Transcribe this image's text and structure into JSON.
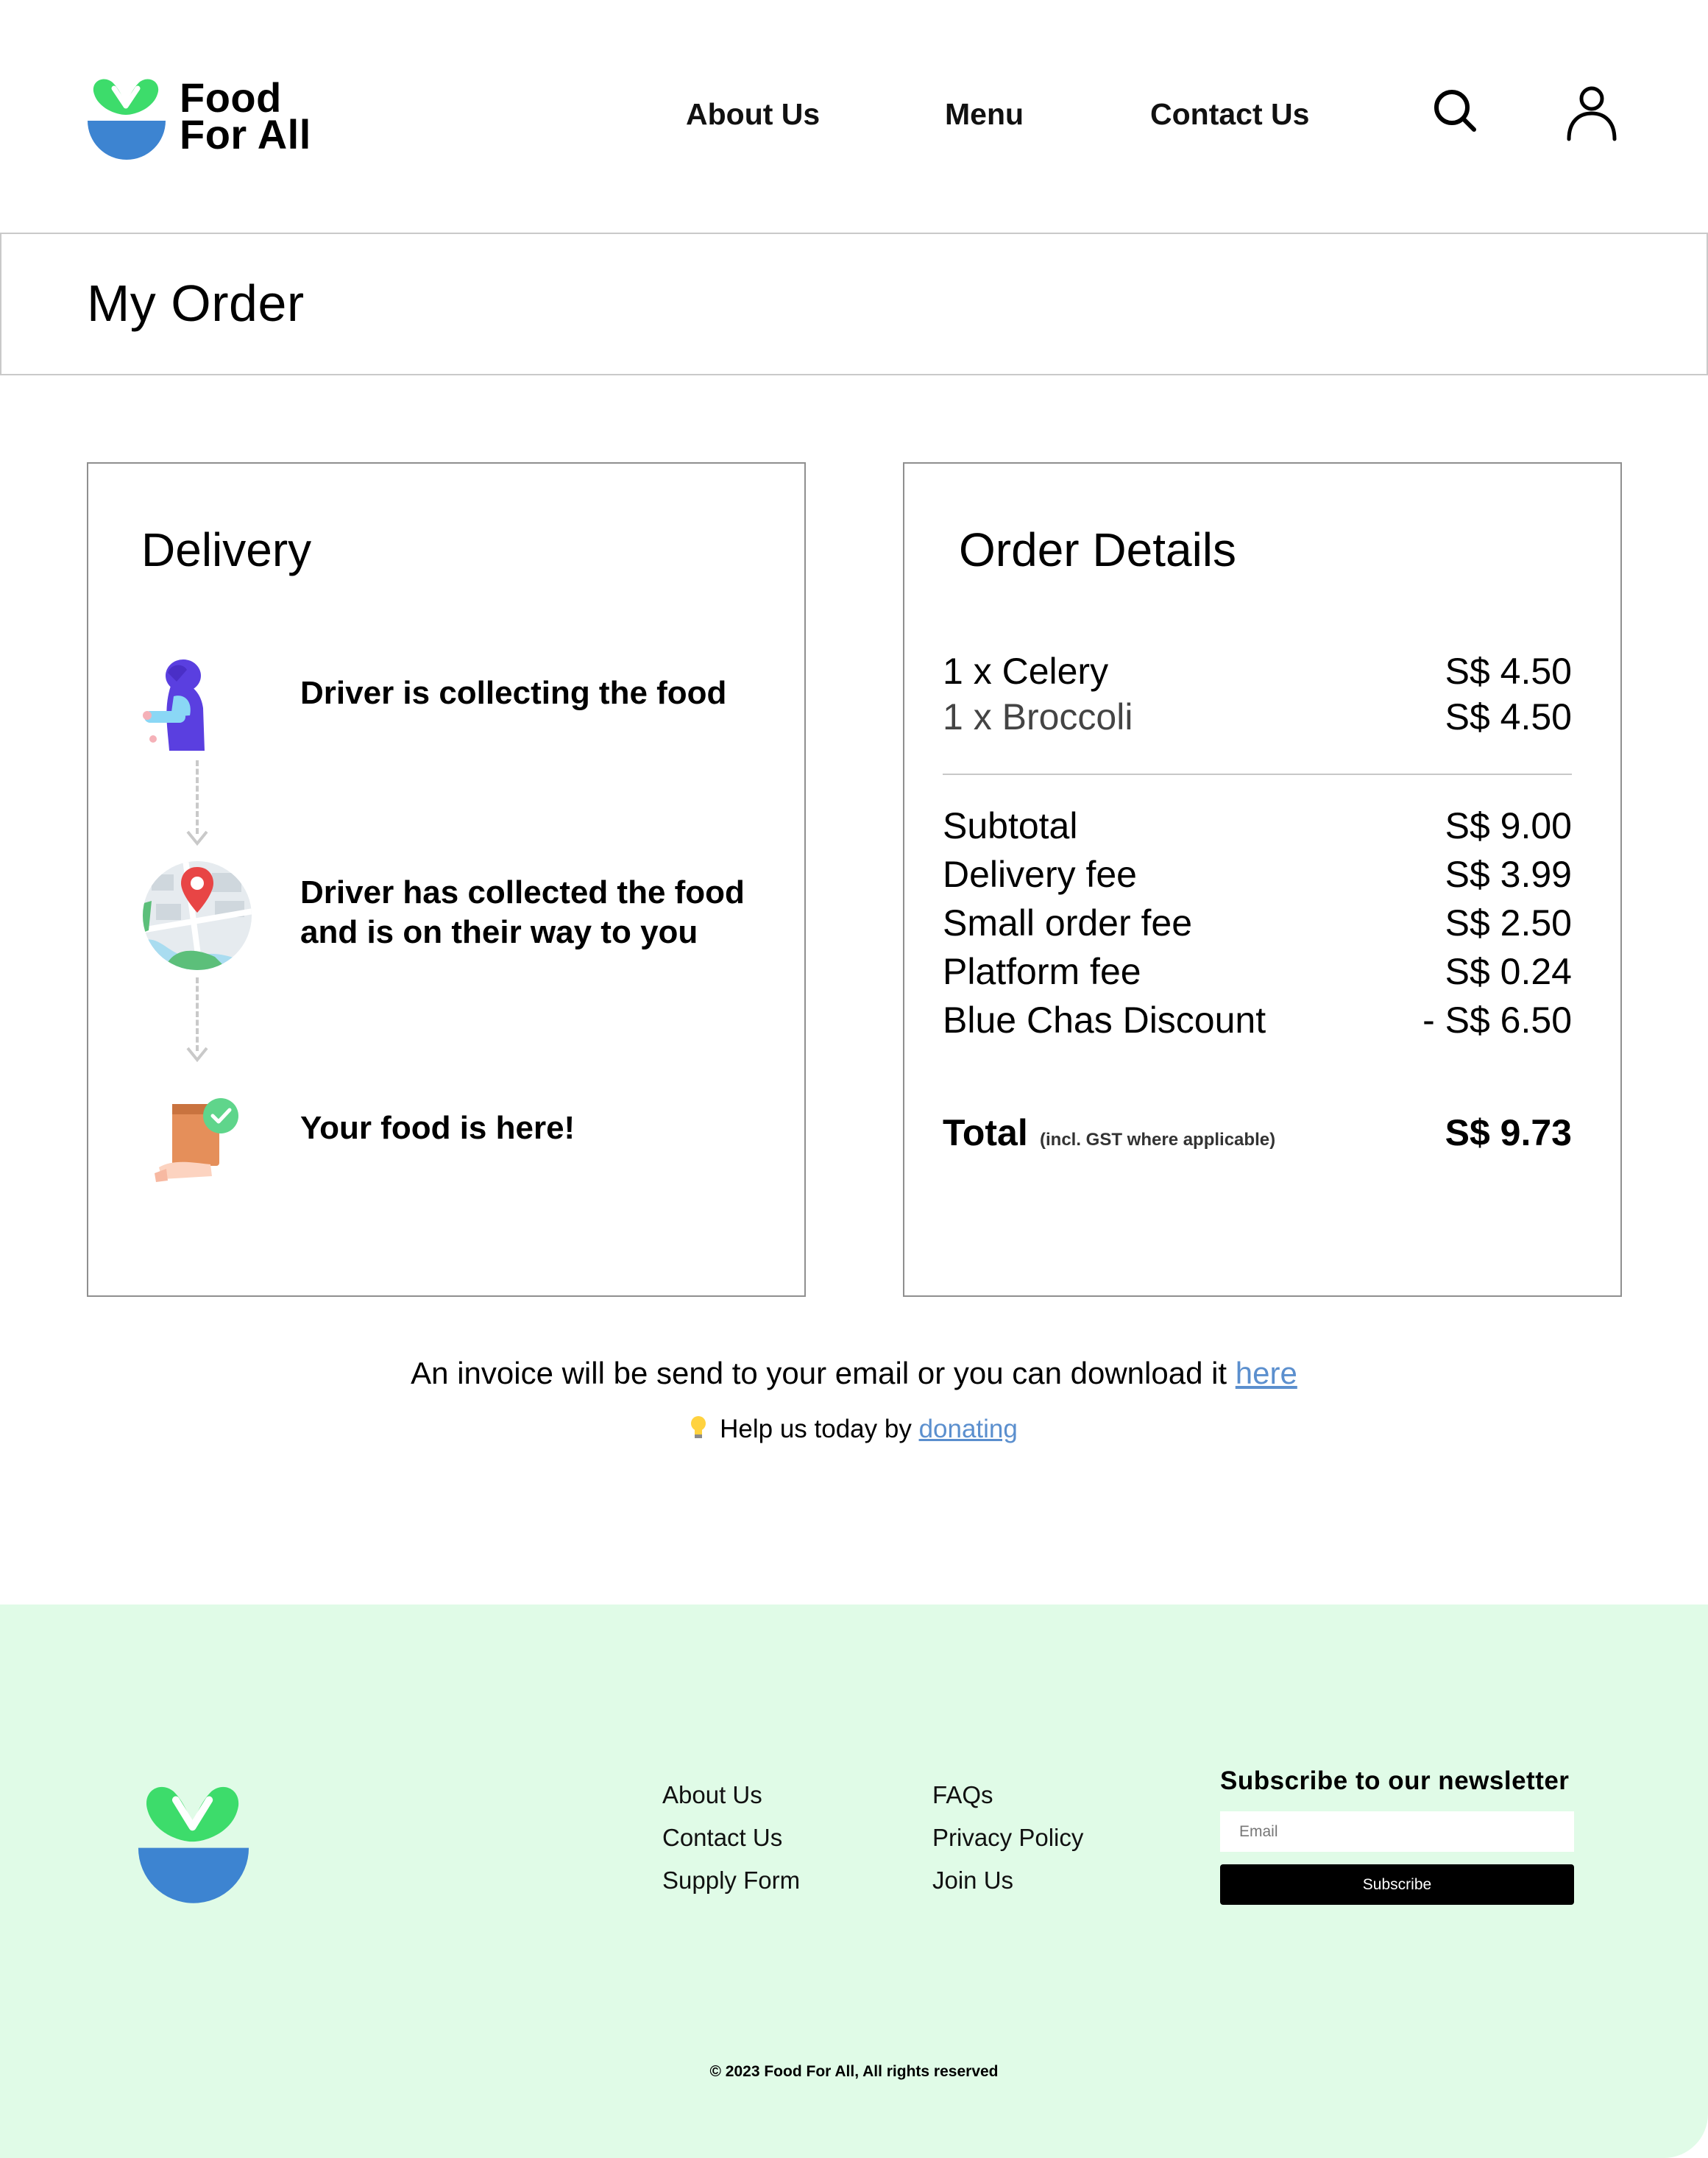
{
  "brand": {
    "line1": "Food",
    "line2": "For All"
  },
  "nav": {
    "about": "About Us",
    "menu": "Menu",
    "contact": "Contact Us"
  },
  "page": {
    "title": "My Order"
  },
  "delivery": {
    "title": "Delivery",
    "steps": [
      {
        "text_lines": [
          "Driver is collecting the food"
        ]
      },
      {
        "text_lines": [
          "Driver has collected the food",
          "and is on their way to you"
        ]
      },
      {
        "text_lines": [
          "Your food is here!"
        ]
      }
    ]
  },
  "order": {
    "title": "Order Details",
    "items": [
      {
        "name": "1 x Celery",
        "price": "S$ 4.50"
      },
      {
        "name": "1 x Broccoli",
        "price": "S$ 4.50"
      }
    ],
    "fees": [
      {
        "name": "Subtotal",
        "price": "S$ 9.00"
      },
      {
        "name": "Delivery fee",
        "price": "S$ 3.99"
      },
      {
        "name": "Small order fee",
        "price": "S$ 2.50"
      },
      {
        "name": "Platform fee",
        "price": "S$ 0.24"
      },
      {
        "name": "Blue Chas Discount",
        "price": "- S$ 6.50"
      }
    ],
    "total_label": "Total",
    "total_note": "(incl. GST where applicable)",
    "total_value": "S$ 9.73"
  },
  "info": {
    "invoice_text": "An invoice will be send to your email or you can download it ",
    "invoice_link": "here",
    "help_text": "Help us today by ",
    "help_link": "donating"
  },
  "footer": {
    "col1": [
      "About Us",
      "Contact Us",
      "Supply Form"
    ],
    "col2": [
      "FAQs",
      "Privacy Policy",
      "Join Us"
    ],
    "newsletter_title": "Subscribe to our newsletter",
    "email_placeholder": "Email",
    "subscribe_label": "Subscribe",
    "copyright": "© 2023 Food For All, All rights reserved"
  },
  "colors": {
    "logo_green": "#3ddc6b",
    "logo_blue": "#3d84d1",
    "footer_bg": "#e0fbe7",
    "link": "#5b8fce"
  },
  "icons": {
    "search": "search-icon",
    "user": "user-icon",
    "driver": "driver-icon",
    "map": "map-pin-icon",
    "delivered": "delivered-package-icon",
    "bulb": "lightbulb-icon"
  }
}
